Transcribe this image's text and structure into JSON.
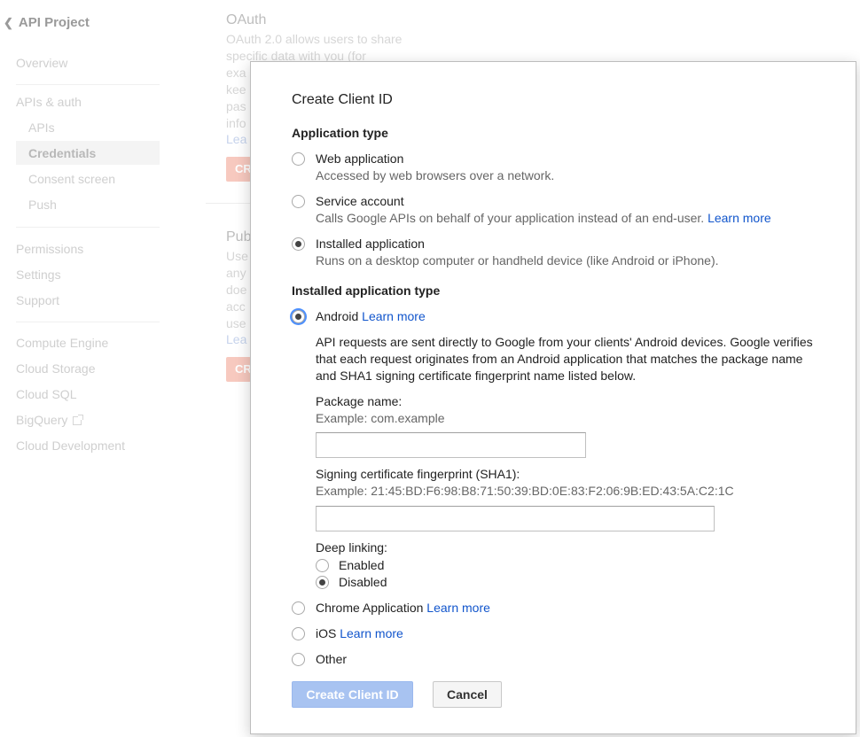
{
  "sidebar": {
    "project_title": "API Project",
    "overview": "Overview",
    "apis_auth": "APIs & auth",
    "apis": "APIs",
    "credentials": "Credentials",
    "consent_screen": "Consent screen",
    "push": "Push",
    "permissions": "Permissions",
    "settings": "Settings",
    "support": "Support",
    "compute_engine": "Compute Engine",
    "cloud_storage": "Cloud Storage",
    "cloud_sql": "Cloud SQL",
    "bigquery": "BigQuery",
    "cloud_development": "Cloud Development"
  },
  "background": {
    "oauth_title": "OAuth",
    "oauth_line1": "OAuth 2.0 allows users to share",
    "oauth_line2": "specific data with you (for",
    "oauth_line3": "exa",
    "oauth_line4": "kee",
    "oauth_line5": "pas",
    "oauth_line6": "info",
    "oauth_link": "Lea",
    "oauth_btn": "CR",
    "public_title": "Pub",
    "public_line1": "Use",
    "public_line2": "any",
    "public_line3": "doe",
    "public_line4": "acc",
    "public_line5": "use",
    "public_link": "Lea",
    "public_btn": "CR"
  },
  "dialog": {
    "title": "Create Client ID",
    "app_type_heading": "Application type",
    "app_types": [
      {
        "label": "Web application",
        "desc": "Accessed by web browsers over a network.",
        "checked": false
      },
      {
        "label": "Service account",
        "desc": "Calls Google APIs on behalf of your application instead of an end-user.",
        "link": "Learn more",
        "checked": false
      },
      {
        "label": "Installed application",
        "desc": "Runs on a desktop computer or handheld device (like Android or iPhone).",
        "checked": true
      }
    ],
    "installed_type_heading": "Installed application type",
    "android": {
      "label": "Android",
      "link": "Learn more",
      "checked": true,
      "description": "API requests are sent directly to Google from your clients' Android devices. Google verifies that each request originates from an Android application that matches the package name and SHA1 signing certificate fingerprint name listed below.",
      "package_label": "Package name:",
      "package_example": "Example: com.example",
      "package_value": "",
      "sha1_label": "Signing certificate fingerprint (SHA1):",
      "sha1_example": "Example: 21:45:BD:F6:98:B8:71:50:39:BD:0E:83:F2:06:9B:ED:43:5A:C2:1C",
      "sha1_value": "",
      "deep_linking_label": "Deep linking:",
      "deep_linking_options": [
        {
          "label": "Enabled",
          "checked": false
        },
        {
          "label": "Disabled",
          "checked": true
        }
      ]
    },
    "other_types": [
      {
        "label": "Chrome Application",
        "link": "Learn more",
        "checked": false
      },
      {
        "label": "iOS",
        "link": "Learn more",
        "checked": false
      },
      {
        "label": "Other",
        "checked": false
      }
    ],
    "create_button": "Create Client ID",
    "cancel_button": "Cancel"
  },
  "colors": {
    "link": "#1155cc",
    "primary_disabled": "#a8c3f1"
  }
}
